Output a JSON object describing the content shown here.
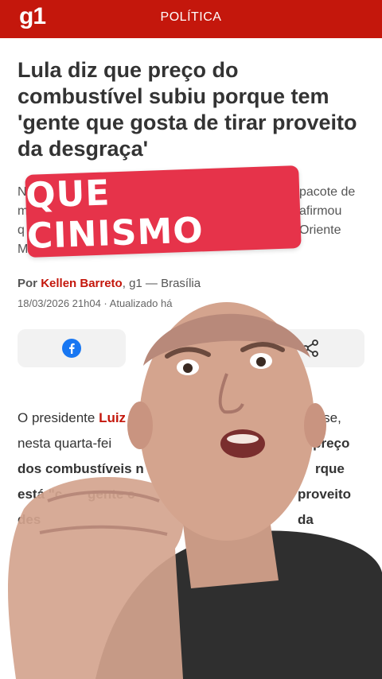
{
  "header": {
    "logo": "g1",
    "section": "POLÍTICA"
  },
  "article": {
    "headline": "Lula diz que preço do combustível subiu porque tem 'gente que gosta de tirar proveito da desgraça'",
    "subtitle_left_fragments": [
      "N",
      "m",
      "q",
      "M"
    ],
    "subtitle_right_fragments": [
      "pacote de",
      "afirmou",
      "Oriente"
    ],
    "byline_prefix": "Por",
    "author": "Kellen Barreto",
    "byline_suffix": ", g1 — Brasília",
    "date": "18/03/2026 21h04 · Atualizado há",
    "body": {
      "line1_start": "O presidente ",
      "line1_link": "Luiz",
      "line1_end": ") disse,",
      "line2_start": "nesta quarta-fei",
      "line2_bold": "o preço",
      "line3_bold_start": "dos combustíveis n",
      "line3_end": "rque",
      "line4_start": "está \"c",
      "line4_mid": " gente c",
      "line4_end": "proveito da",
      "line5_start": "des"
    }
  },
  "overlay": {
    "text": "QUE CINISMO"
  },
  "icons": {
    "facebook": "facebook-icon",
    "share": "share-icon"
  },
  "colors": {
    "brand": "#c4170c",
    "overlay": "#e6334a",
    "facebook": "#1877f2"
  }
}
